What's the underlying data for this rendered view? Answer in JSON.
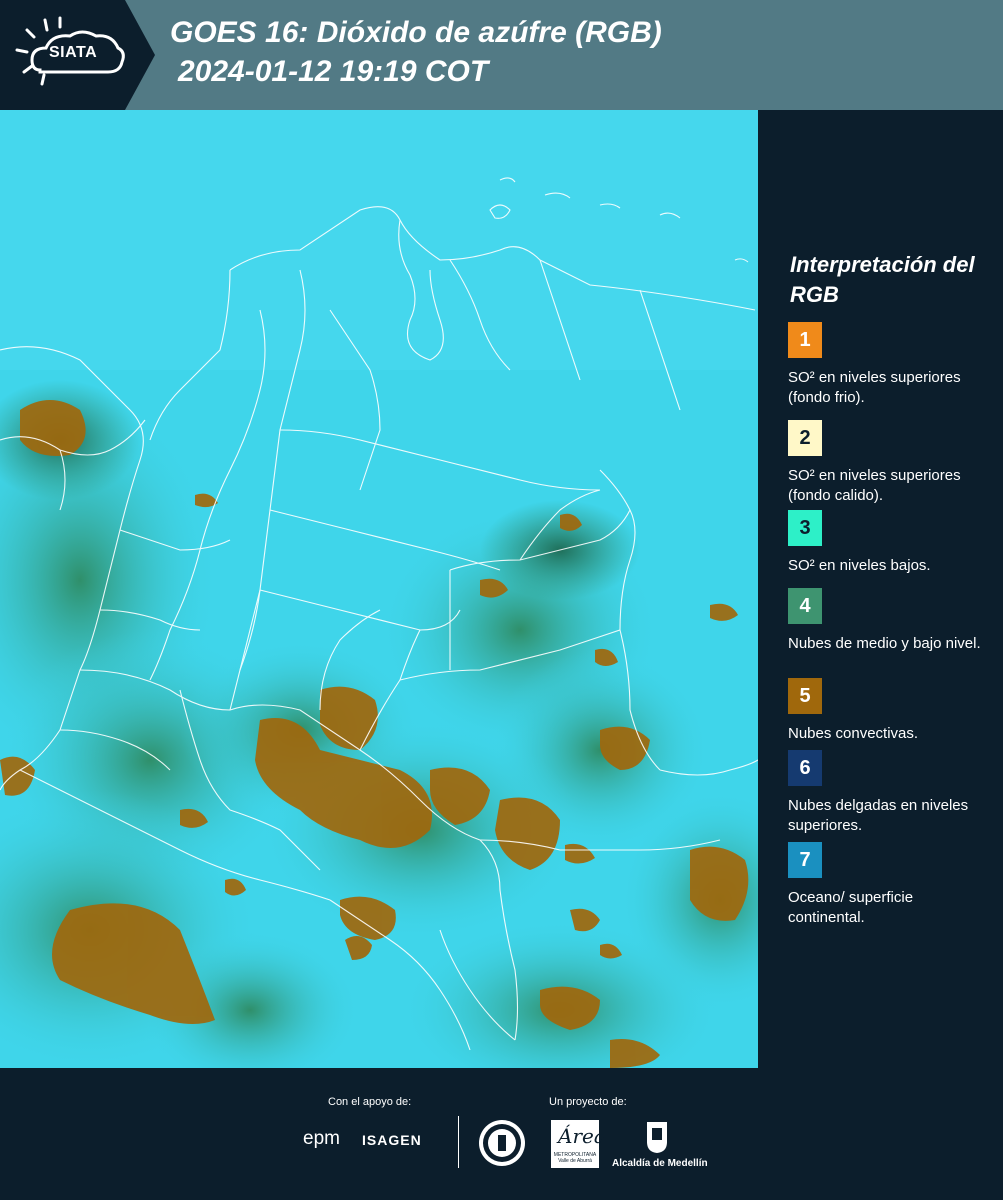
{
  "header": {
    "logo_text": "SIATA",
    "title_line1": "GOES 16: Dióxido de azúfre (RGB)",
    "title_line2": "2024-01-12 19:19 COT"
  },
  "legend": {
    "title": "Interpretación del RGB",
    "items": [
      {
        "number": "1",
        "color": "#f08a1a",
        "text_color": "#ffffff",
        "label": "SO² en niveles superiores (fondo frio)."
      },
      {
        "number": "2",
        "color": "#fff8c8",
        "text_color": "#0c1e2c",
        "label": "SO² en niveles superiores (fondo calido)."
      },
      {
        "number": "3",
        "color": "#2df0c8",
        "text_color": "#0c1e2c",
        "label": "SO² en niveles bajos."
      },
      {
        "number": "4",
        "color": "#3e9470",
        "text_color": "#ffffff",
        "label": "Nubes de medio y bajo nivel."
      },
      {
        "number": "5",
        "color": "#a0680c",
        "text_color": "#ffffff",
        "label": "Nubes convectivas."
      },
      {
        "number": "6",
        "color": "#153a70",
        "text_color": "#ffffff",
        "label": "Nubes delgadas en niveles superiores."
      },
      {
        "number": "7",
        "color": "#1a90c0",
        "text_color": "#ffffff",
        "label": "Oceano/ superficie continental."
      }
    ]
  },
  "footer": {
    "support_label": "Con el apoyo de:",
    "project_label": "Un proyecto de:",
    "sponsors": {
      "epm": "epm",
      "isagen": "ISAGEN",
      "area": "Área",
      "area_subtitle": "METROPOLITANA Valle de Aburrá",
      "alcaldia": "Alcaldía de Medellín"
    }
  },
  "colors": {
    "ocean": "#3fd5ea",
    "land_green": "#2f8f6a",
    "convective": "#a0680c",
    "background": "#0c1e2c",
    "header": "#527a85"
  }
}
